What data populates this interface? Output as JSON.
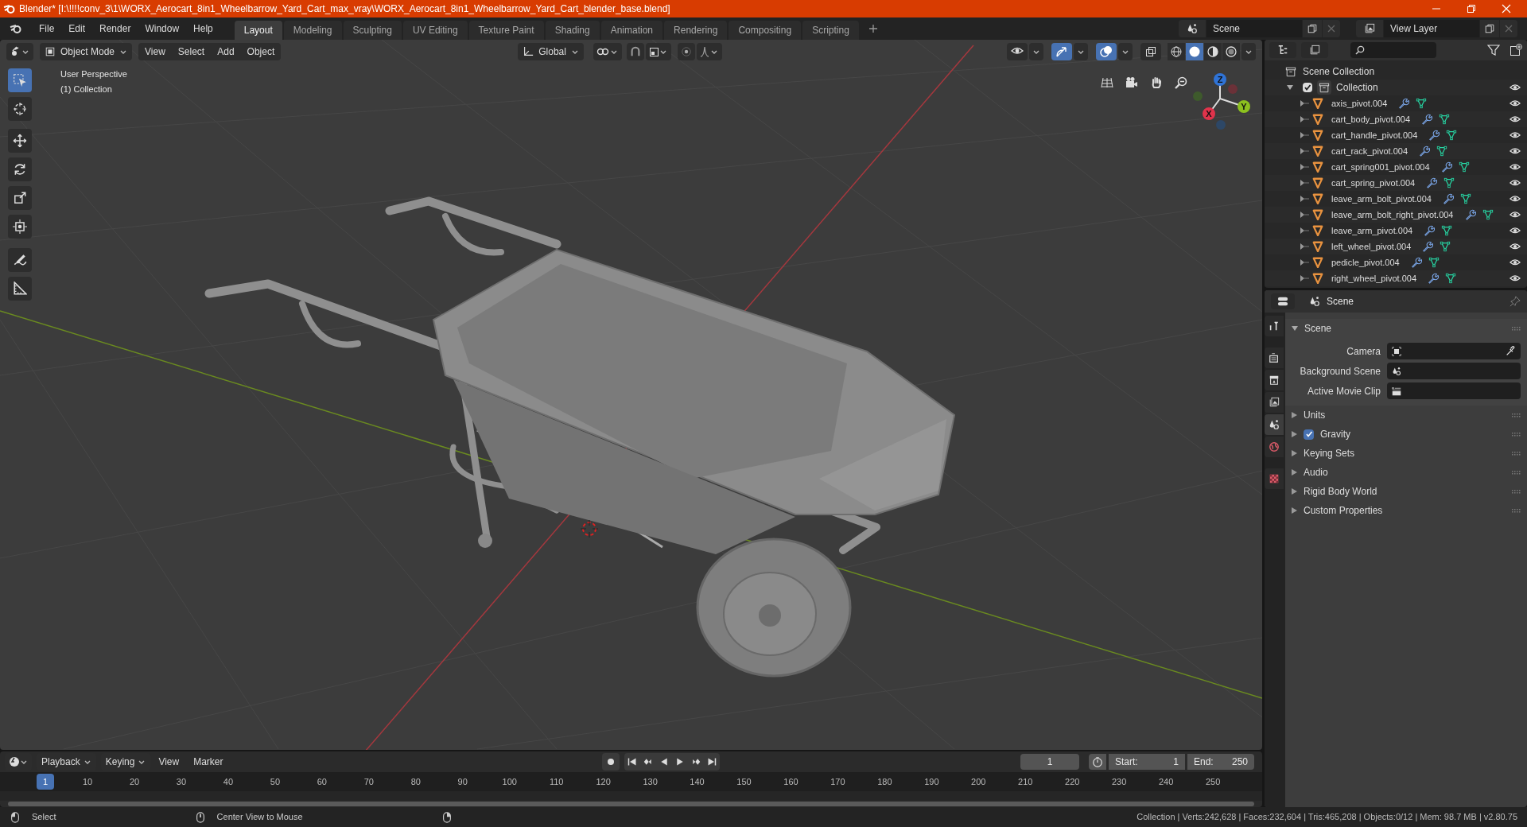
{
  "window": {
    "title": "Blender* [I:\\!!!!conv_3\\1\\WORX_Aerocart_8in1_Wheelbarrow_Yard_Cart_max_vray\\WORX_Aerocart_8in1_Wheelbarrow_Yard_Cart_blender_base.blend]"
  },
  "menu": [
    "File",
    "Edit",
    "Render",
    "Window",
    "Help"
  ],
  "workspaces": [
    {
      "label": "Layout",
      "selected": true
    },
    {
      "label": "Modeling",
      "selected": false
    },
    {
      "label": "Sculpting",
      "selected": false
    },
    {
      "label": "UV Editing",
      "selected": false
    },
    {
      "label": "Texture Paint",
      "selected": false
    },
    {
      "label": "Shading",
      "selected": false
    },
    {
      "label": "Animation",
      "selected": false
    },
    {
      "label": "Rendering",
      "selected": false
    },
    {
      "label": "Compositing",
      "selected": false
    },
    {
      "label": "Scripting",
      "selected": false
    }
  ],
  "scene": "Scene",
  "view_layer": "View Layer",
  "viewport": {
    "mode": "Object Mode",
    "menus": [
      "View",
      "Select",
      "Add",
      "Object"
    ],
    "orientation": "Global",
    "toggles": [
      {
        "kind": "visibility",
        "on": false
      },
      {
        "kind": "gizmo",
        "on": true
      },
      {
        "kind": "overlay",
        "on": true
      },
      {
        "kind": "xray",
        "on": false
      }
    ],
    "shading": [
      {
        "kind": "wireframe",
        "selected": false
      },
      {
        "kind": "solid",
        "selected": true
      },
      {
        "kind": "material",
        "selected": false
      },
      {
        "kind": "rendered",
        "selected": false
      }
    ],
    "overlay_lines": [
      "User Perspective",
      "(1) Collection"
    ],
    "axes": {
      "x": "X",
      "y": "Y",
      "z": "Z"
    },
    "tools": [
      {
        "kind": "select",
        "selected": true
      },
      {
        "kind": "cursor",
        "selected": false
      },
      {
        "kind": "move",
        "selected": false
      },
      {
        "kind": "rotate",
        "selected": false
      },
      {
        "kind": "scale",
        "selected": false
      },
      {
        "kind": "transform",
        "selected": false
      },
      {
        "kind": "annotate",
        "selected": false
      },
      {
        "kind": "measure",
        "selected": false
      }
    ]
  },
  "outliner": {
    "root": "Scene Collection",
    "collection": {
      "label": "Collection",
      "checked": true,
      "expanded": true,
      "children": [
        {
          "label": "axis_pivot.004"
        },
        {
          "label": "cart_body_pivot.004"
        },
        {
          "label": "cart_handle_pivot.004"
        },
        {
          "label": "cart_rack_pivot.004"
        },
        {
          "label": "cart_spring001_pivot.004"
        },
        {
          "label": "cart_spring_pivot.004"
        },
        {
          "label": "leave_arm_bolt_pivot.004"
        },
        {
          "label": "leave_arm_bolt_right_pivot.004"
        },
        {
          "label": "leave_arm_pivot.004"
        },
        {
          "label": "left_wheel_pivot.004"
        },
        {
          "label": "pedicle_pivot.004"
        },
        {
          "label": "right_wheel_pivot.004"
        }
      ]
    }
  },
  "properties": {
    "header": "Scene",
    "tabs": [
      {
        "kind": "tool",
        "selected": false
      },
      {
        "kind": "render",
        "selected": false
      },
      {
        "kind": "output",
        "selected": false
      },
      {
        "kind": "view_layer",
        "selected": false
      },
      {
        "kind": "scene",
        "selected": true
      },
      {
        "kind": "world",
        "selected": false
      },
      {
        "kind": "texture",
        "selected": false
      }
    ],
    "panel": {
      "title": "Scene",
      "expanded": true,
      "fields": [
        {
          "label": "Camera",
          "kind": "camera"
        },
        {
          "label": "Background Scene",
          "kind": "scene"
        },
        {
          "label": "Active Movie Clip",
          "kind": "clip"
        }
      ]
    },
    "sections": [
      {
        "label": "Units",
        "kind": "plain"
      },
      {
        "label": "Gravity",
        "kind": "toggle",
        "checked": true
      },
      {
        "label": "Keying Sets",
        "kind": "plain"
      },
      {
        "label": "Audio",
        "kind": "plain"
      },
      {
        "label": "Rigid Body World",
        "kind": "plain"
      },
      {
        "label": "Custom Properties",
        "kind": "plain"
      }
    ]
  },
  "timeline": {
    "menus": [
      "Playback",
      "Keying",
      "View",
      "Marker"
    ],
    "current_frame": "1",
    "start_label": "Start:",
    "start": "1",
    "end_label": "End:",
    "end": "250",
    "playhead": "1",
    "ticks": [
      "10",
      "20",
      "30",
      "40",
      "50",
      "60",
      "70",
      "80",
      "90",
      "100",
      "110",
      "120",
      "130",
      "140",
      "150",
      "160",
      "170",
      "180",
      "190",
      "200",
      "210",
      "220",
      "230",
      "240",
      "250"
    ]
  },
  "status_bar": {
    "items": [
      {
        "kind": "left",
        "label": "Select"
      },
      {
        "kind": "middle",
        "label": "Center View to Mouse"
      },
      {
        "kind": "right"
      }
    ],
    "stats": "Collection | Verts:242,628 | Faces:232,604 | Tris:465,208 | Objects:0/12 | Mem: 98.7 MB | v2.80.75"
  }
}
